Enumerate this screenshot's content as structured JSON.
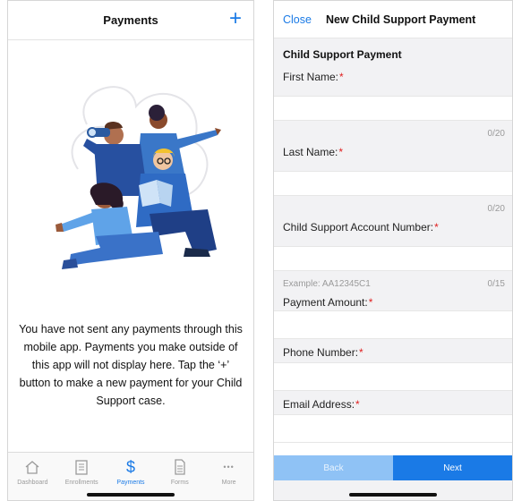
{
  "left": {
    "header": {
      "title": "Payments",
      "add_symbol": "+"
    },
    "empty_message": "You have not sent any payments through this mobile app. Payments you make outside of this app will not display here. Tap the ‘+’ button to make a new payment for your Child Support case.",
    "tabs": [
      {
        "label": "Dashboard",
        "icon": "home-icon"
      },
      {
        "label": "Enrollments",
        "icon": "clipboard-icon"
      },
      {
        "label": "Payments",
        "icon": "dollar-icon",
        "active": true
      },
      {
        "label": "Forms",
        "icon": "document-icon"
      },
      {
        "label": "More",
        "icon": "ellipsis-icon"
      }
    ],
    "dollar_glyph": "$",
    "more_glyph": "•••"
  },
  "right": {
    "header": {
      "close_label": "Close",
      "title": "New Child Support Payment"
    },
    "section_title": "Child Support Payment",
    "fields": {
      "first_name": {
        "label": "First Name:",
        "counter": "0/20"
      },
      "last_name": {
        "label": "Last Name:",
        "counter": "0/20"
      },
      "account_number": {
        "label": "Child Support Account Number:",
        "placeholder": "Example: AA12345C1",
        "counter": "0/15"
      },
      "payment_amount": {
        "label": "Payment Amount:"
      },
      "phone_number": {
        "label": "Phone Number:"
      },
      "email_address": {
        "label": "Email Address:"
      }
    },
    "required_mark": "*",
    "buttons": {
      "back": "Back",
      "next": "Next"
    }
  },
  "colors": {
    "accent": "#1a7ae6",
    "back_button": "#8fc2f5",
    "required": "#e02020",
    "form_background": "#f2f2f4"
  }
}
